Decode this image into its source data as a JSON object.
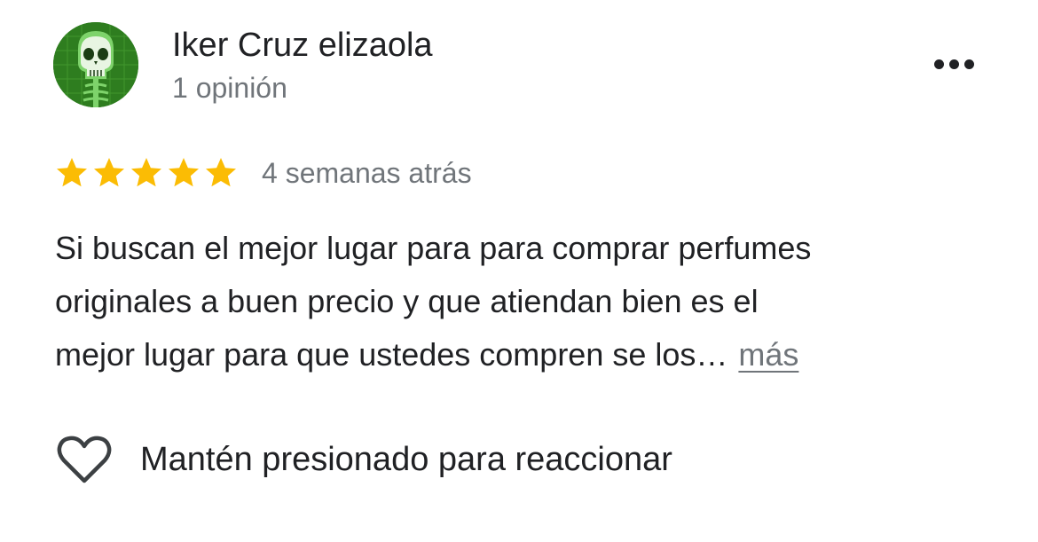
{
  "review": {
    "author": {
      "name": "Iker Cruz elizaola",
      "review_count": "1 opinión",
      "avatar_icon": "skull-avatar-icon",
      "avatar_color": "#2e7d1f"
    },
    "menu_icon": "more-options-icon",
    "rating": {
      "stars": 5,
      "max_stars": 5,
      "star_color": "#fbbc04"
    },
    "date": "4 semanas atrás",
    "text_lines": [
      "Si buscan el mejor lugar para para comprar perfumes",
      "originales a buen precio y que atiendan bien es el",
      "mejor lugar para que ustedes compren se los…"
    ],
    "more_label": "más",
    "reaction": {
      "icon": "heart-outline-icon",
      "label": "Mantén presionado para reaccionar"
    }
  }
}
